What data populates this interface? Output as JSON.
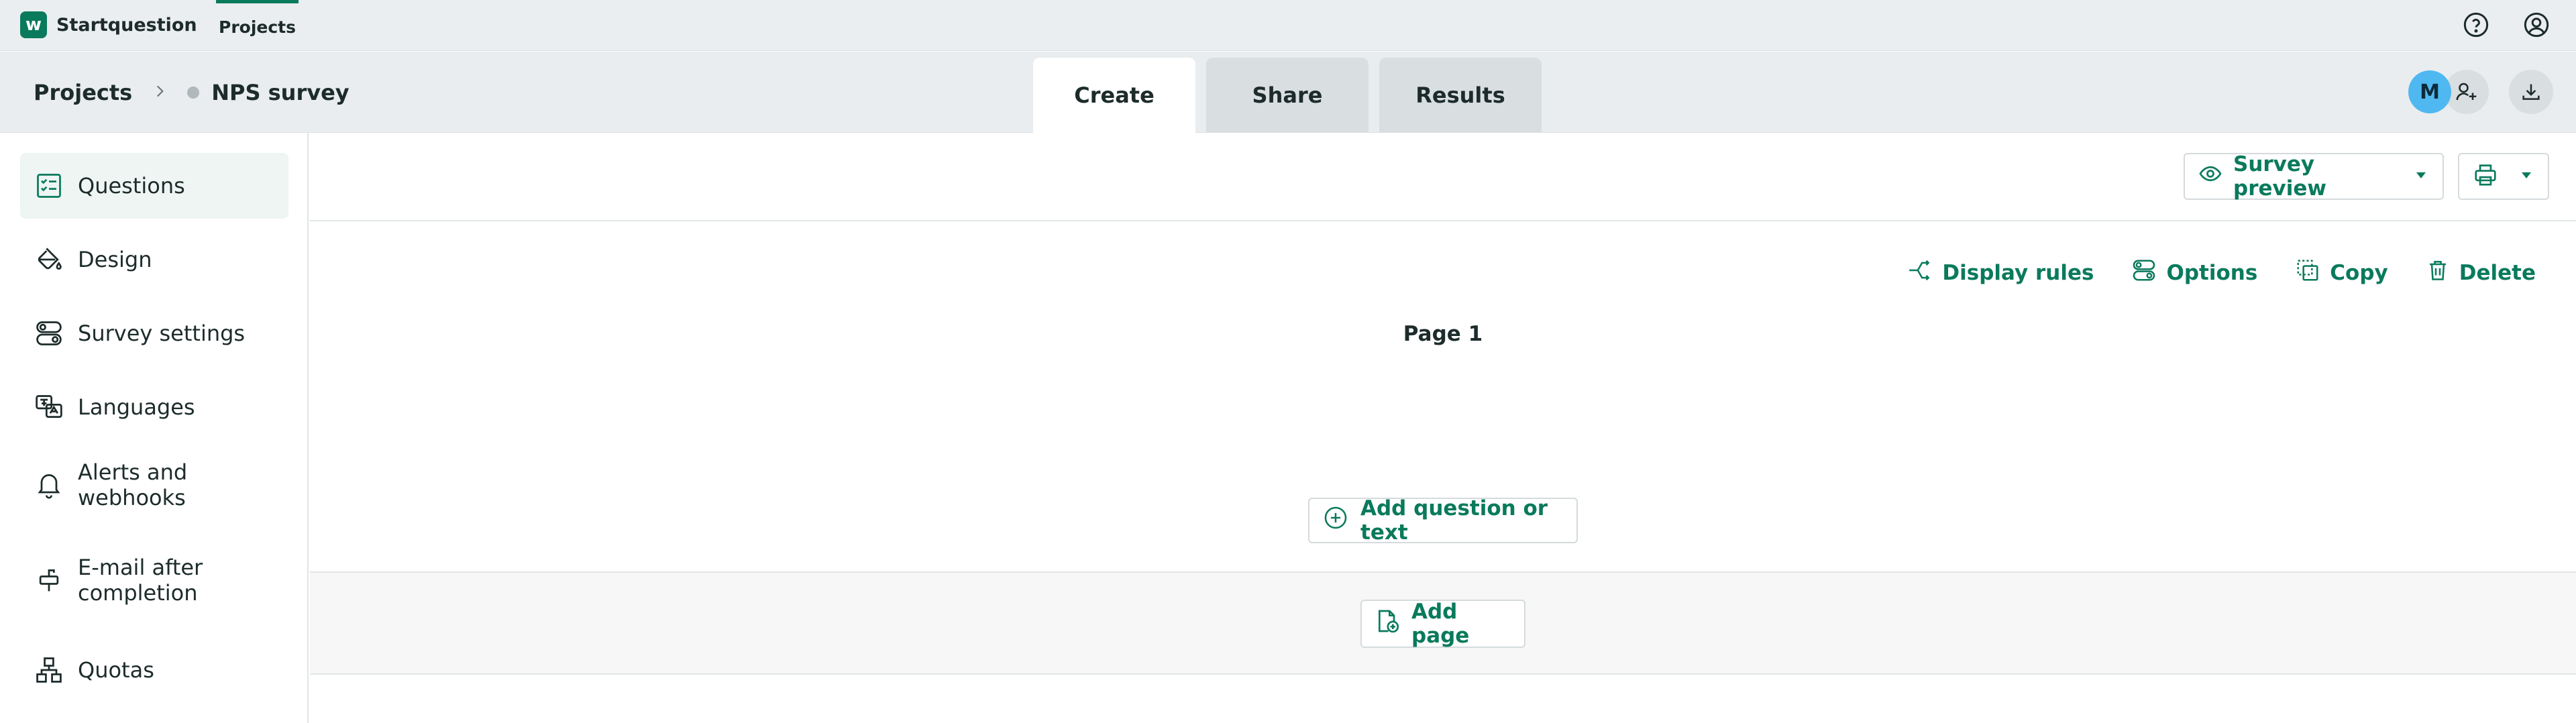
{
  "app": {
    "name": "Startquestion",
    "logo_letter": "w"
  },
  "top_nav": {
    "projects": "Projects"
  },
  "breadcrumb": {
    "root": "Projects",
    "separator": ">",
    "current": "NPS survey"
  },
  "tabs": [
    {
      "label": "Create",
      "active": true
    },
    {
      "label": "Share",
      "active": false
    },
    {
      "label": "Results",
      "active": false
    }
  ],
  "user": {
    "initial": "M"
  },
  "sidebar": {
    "items": [
      {
        "label": "Questions",
        "icon": "checklist-icon",
        "active": true
      },
      {
        "label": "Design",
        "icon": "paint-bucket-icon"
      },
      {
        "label": "Survey settings",
        "icon": "toggles-icon"
      },
      {
        "label": "Languages",
        "icon": "translate-icon"
      },
      {
        "label": "Alerts and webhooks",
        "icon": "bell-icon"
      },
      {
        "label": "E-mail after completion",
        "icon": "mailbox-icon"
      },
      {
        "label": "Quotas",
        "icon": "hierarchy-icon"
      }
    ]
  },
  "toolbar": {
    "survey_preview": "Survey preview"
  },
  "page_actions": {
    "display_rules": "Display rules",
    "options": "Options",
    "copy": "Copy",
    "delete": "Delete"
  },
  "page": {
    "title": "Page 1",
    "add_question": "Add question or text",
    "add_page": "Add page"
  },
  "colors": {
    "accent": "#0a7a5c",
    "avatar": "#4fb8f0",
    "topbar": "#ebeef0"
  }
}
